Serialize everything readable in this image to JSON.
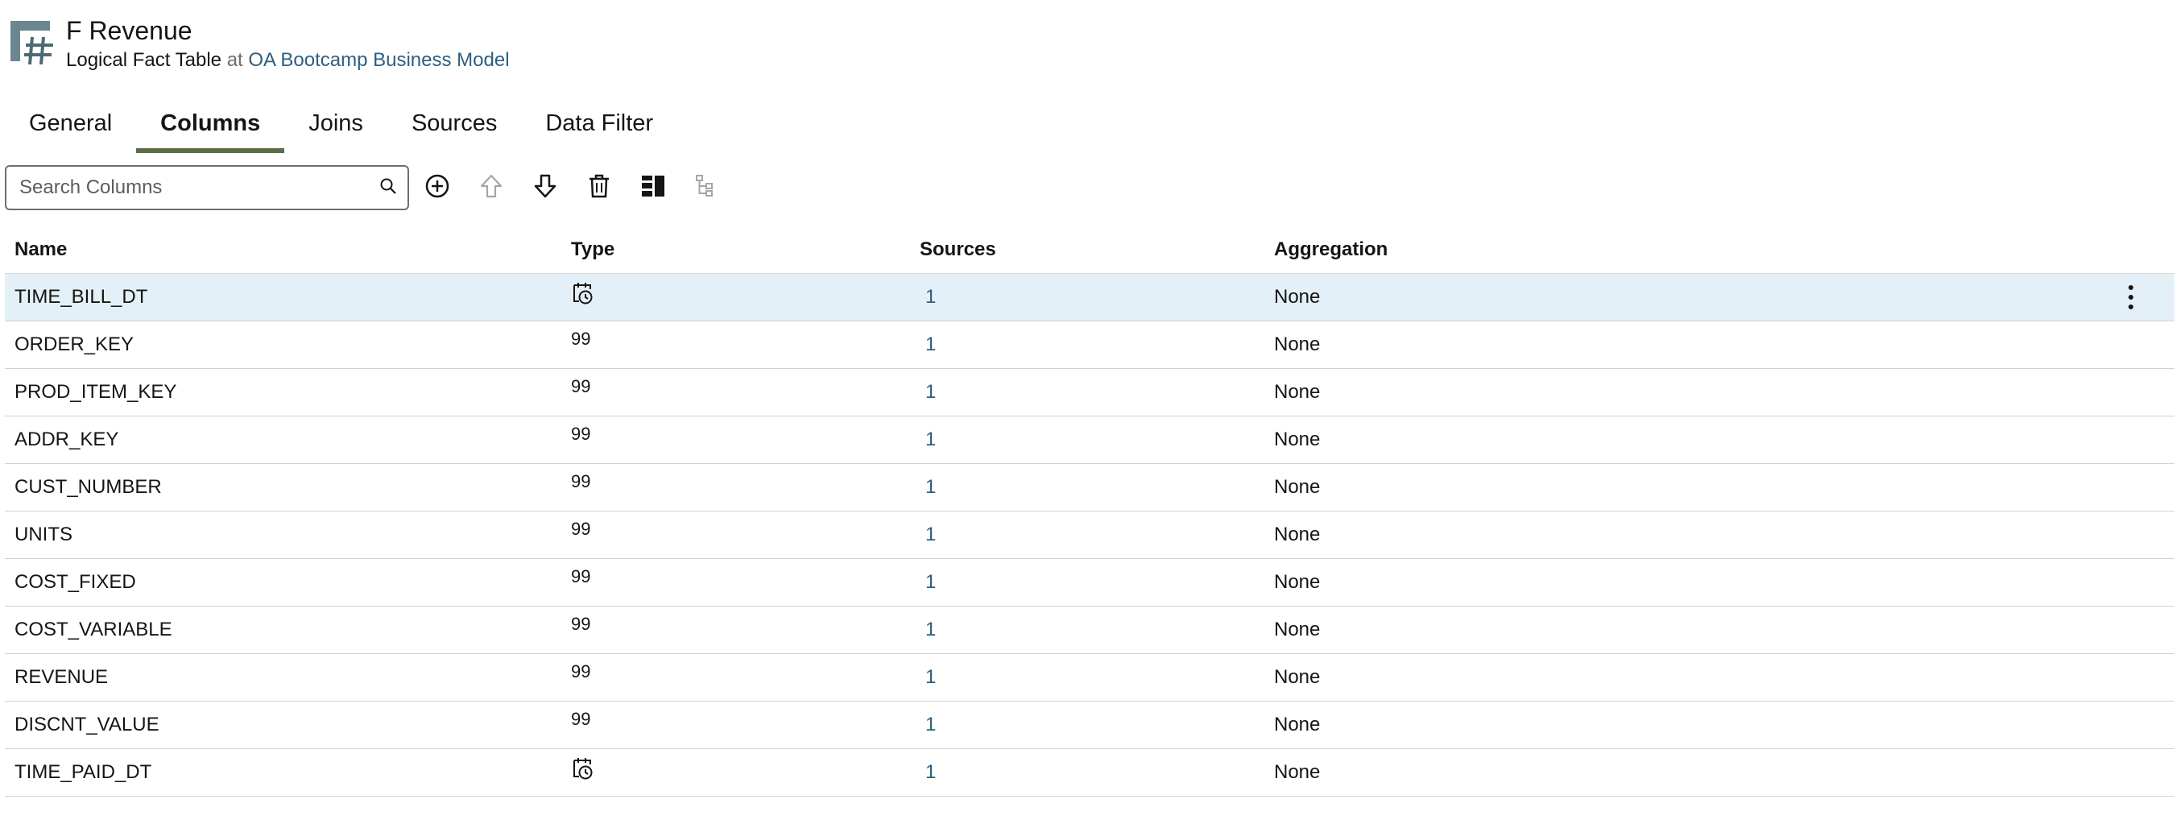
{
  "header": {
    "title": "F Revenue",
    "subtitle_prefix": "Logical Fact Table",
    "subtitle_at": "at",
    "subtitle_link": "OA Bootcamp Business Model",
    "icon": "logical-fact-table-icon"
  },
  "tabs": [
    {
      "label": "General",
      "selected": false
    },
    {
      "label": "Columns",
      "selected": true
    },
    {
      "label": "Joins",
      "selected": false
    },
    {
      "label": "Sources",
      "selected": false
    },
    {
      "label": "Data Filter",
      "selected": false
    }
  ],
  "toolbar": {
    "search_placeholder": "Search Columns",
    "buttons": [
      "add-circle-icon",
      "move-up-icon",
      "move-down-icon",
      "delete-icon",
      "columns-layout-icon",
      "hierarchy-icon"
    ]
  },
  "table": {
    "headers": {
      "name": "Name",
      "type": "Type",
      "sources": "Sources",
      "aggregation": "Aggregation"
    },
    "rows": [
      {
        "name": "TIME_BILL_DT",
        "type": "",
        "type_icon": "date-time-icon",
        "sources": "1",
        "aggregation": "None"
      },
      {
        "name": "ORDER_KEY",
        "type": "99",
        "sources": "1",
        "aggregation": "None"
      },
      {
        "name": "PROD_ITEM_KEY",
        "type": "99",
        "sources": "1",
        "aggregation": "None"
      },
      {
        "name": "ADDR_KEY",
        "type": "99",
        "sources": "1",
        "aggregation": "None"
      },
      {
        "name": "CUST_NUMBER",
        "type": "99",
        "sources": "1",
        "aggregation": "None"
      },
      {
        "name": "UNITS",
        "type": "99",
        "sources": "1",
        "aggregation": "None"
      },
      {
        "name": "COST_FIXED",
        "type": "99",
        "sources": "1",
        "aggregation": "None"
      },
      {
        "name": "COST_VARIABLE",
        "type": "99",
        "sources": "1",
        "aggregation": "None"
      },
      {
        "name": "REVENUE",
        "type": "99",
        "sources": "1",
        "aggregation": "None"
      },
      {
        "name": "DISCNT_VALUE",
        "type": "99",
        "sources": "1",
        "aggregation": "None"
      },
      {
        "name": "TIME_PAID_DT",
        "type": "",
        "type_icon": "date-time-icon",
        "sources": "1",
        "aggregation": "None"
      }
    ]
  },
  "colors": {
    "accent_tab_underline": "#5a6d48",
    "link": "#2d5f7f",
    "selected_row": "#e4f0f7"
  }
}
